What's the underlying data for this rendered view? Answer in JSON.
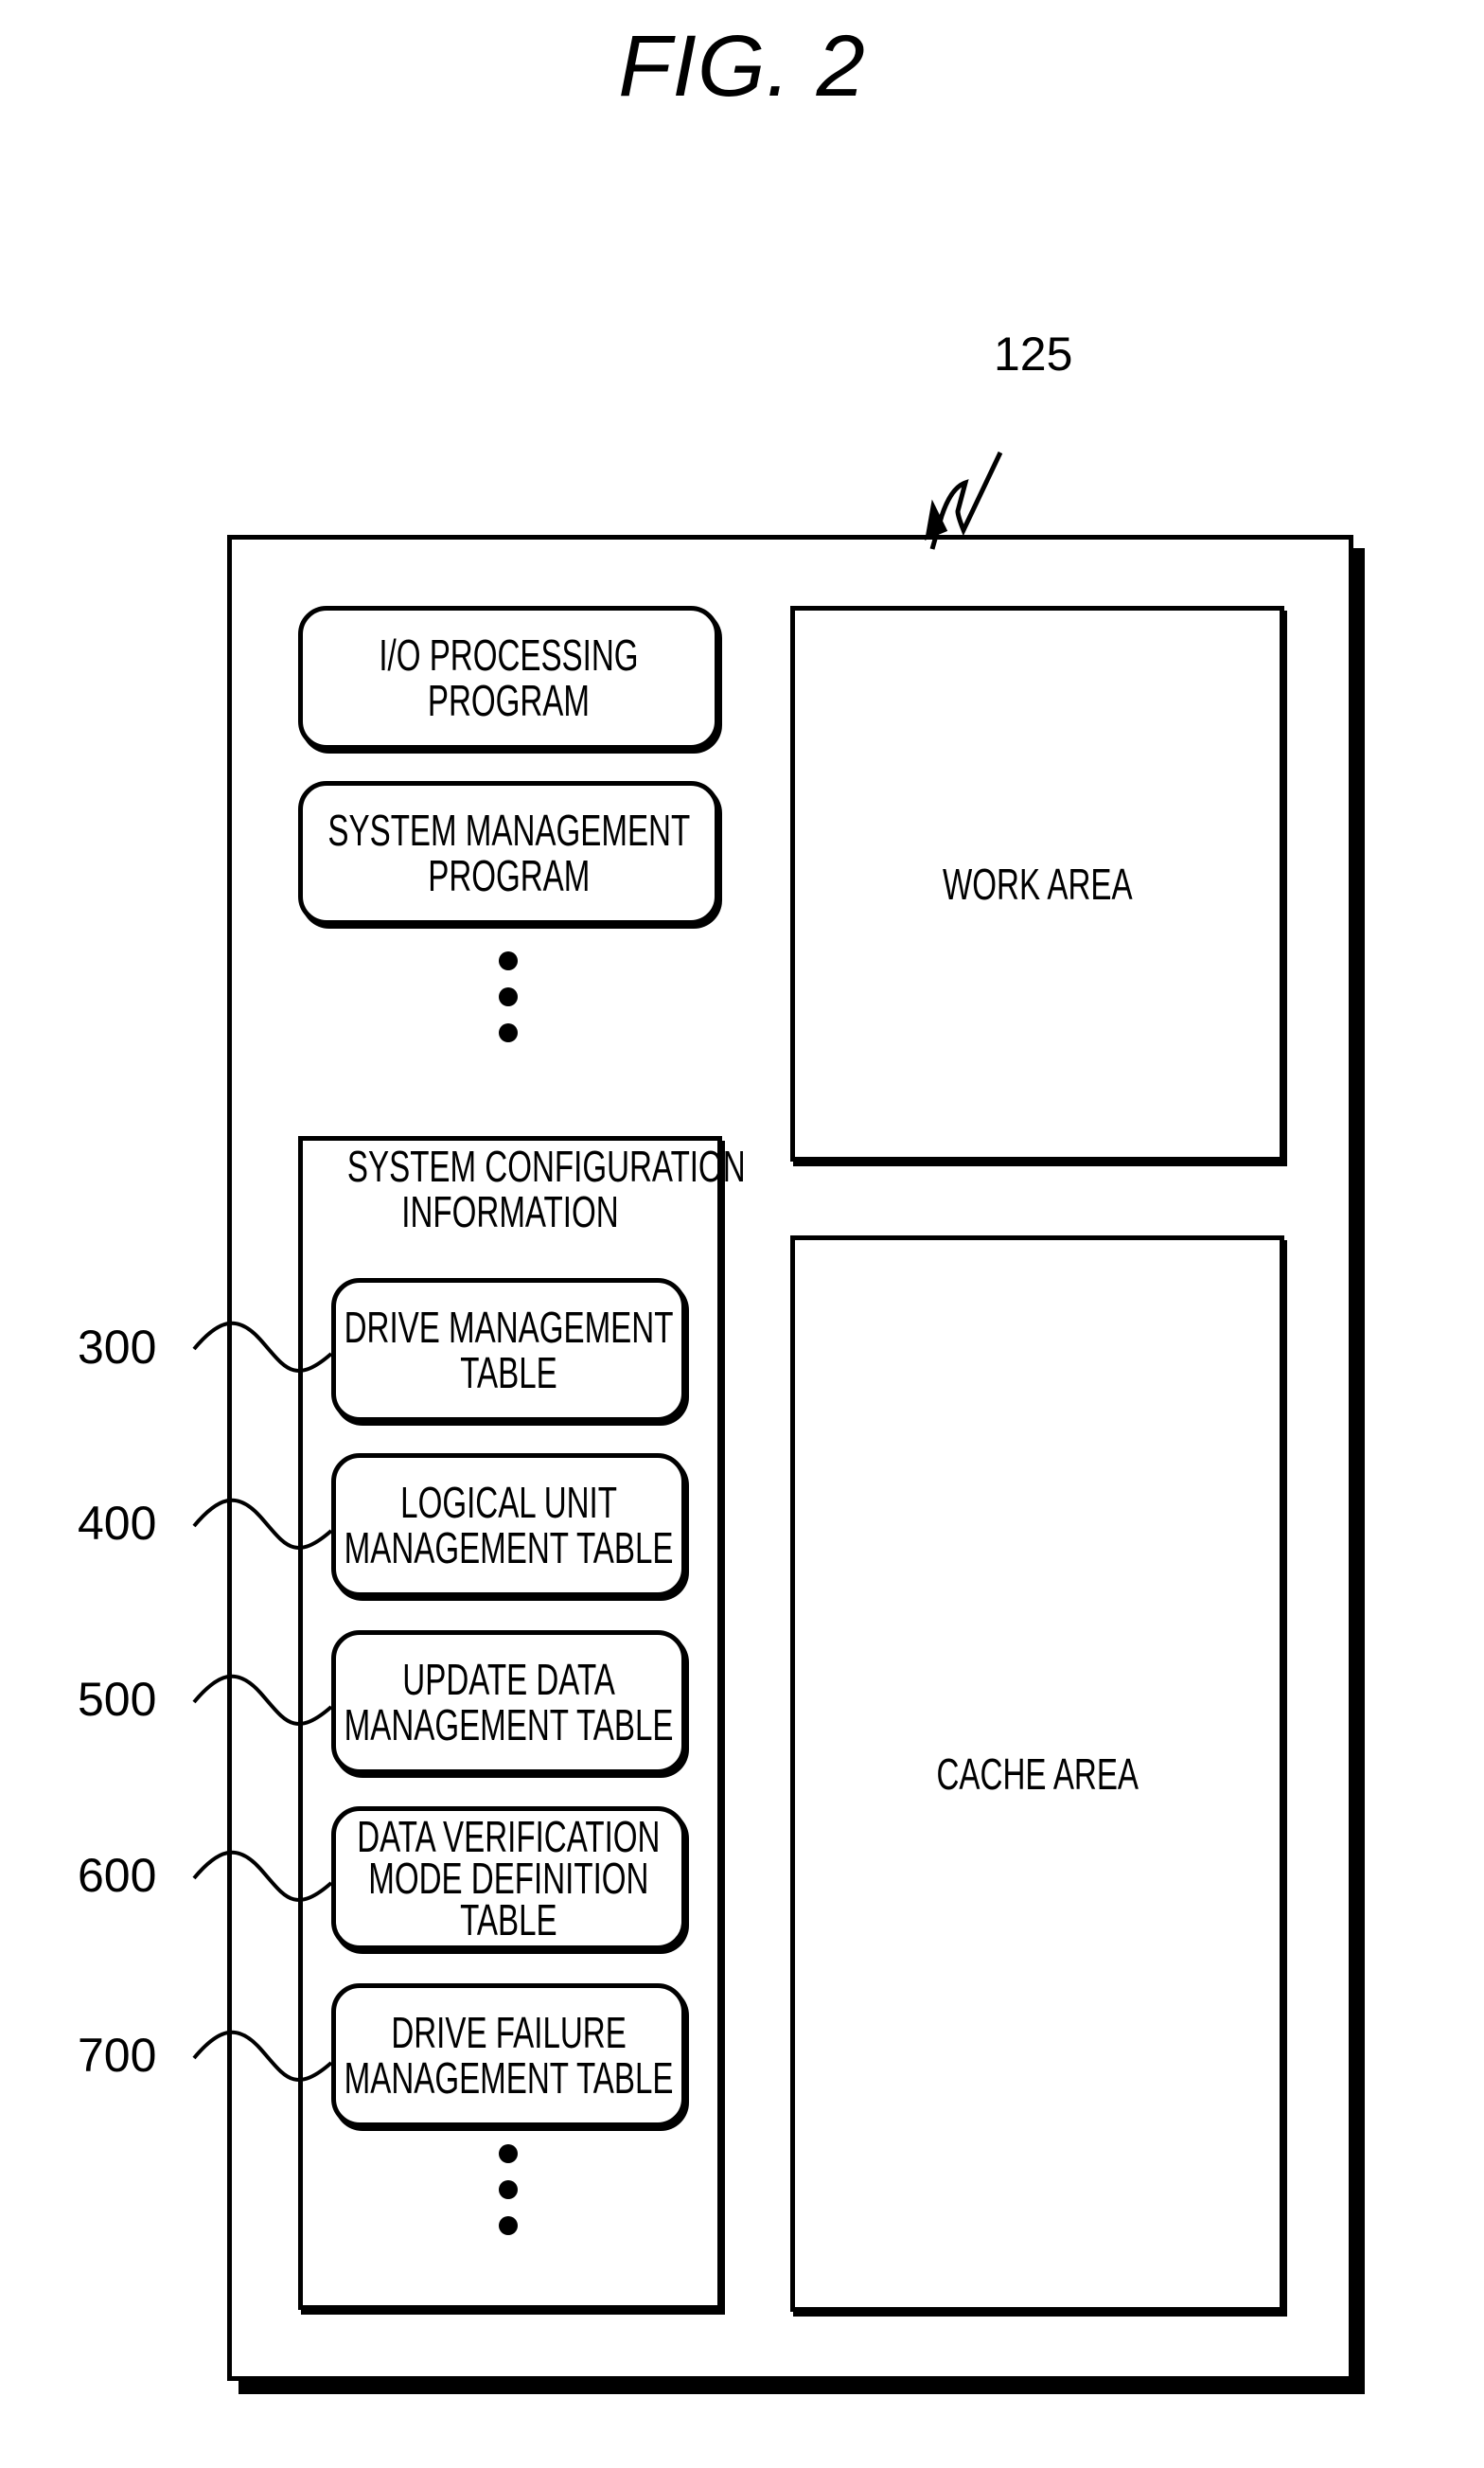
{
  "figure": {
    "title": "FIG. 2",
    "memory_ref": "125"
  },
  "memory": {
    "programs": [
      {
        "label_line1": "I/O PROCESSING",
        "label_line2": "PROGRAM"
      },
      {
        "label_line1": "SYSTEM MANAGEMENT",
        "label_line2": "PROGRAM"
      }
    ],
    "system_config": {
      "title_line1": "SYSTEM CONFIGURATION",
      "title_line2": "INFORMATION",
      "tables": [
        {
          "ref": "300",
          "lines": [
            "DRIVE MANAGEMENT",
            "TABLE"
          ]
        },
        {
          "ref": "400",
          "lines": [
            "LOGICAL UNIT",
            "MANAGEMENT TABLE"
          ]
        },
        {
          "ref": "500",
          "lines": [
            "UPDATE DATA",
            "MANAGEMENT TABLE"
          ]
        },
        {
          "ref": "600",
          "lines": [
            "DATA VERIFICATION",
            "MODE DEFINITION",
            "TABLE"
          ]
        },
        {
          "ref": "700",
          "lines": [
            "DRIVE FAILURE",
            "MANAGEMENT TABLE"
          ]
        }
      ]
    },
    "work_area": "WORK AREA",
    "cache_area": "CACHE AREA"
  }
}
